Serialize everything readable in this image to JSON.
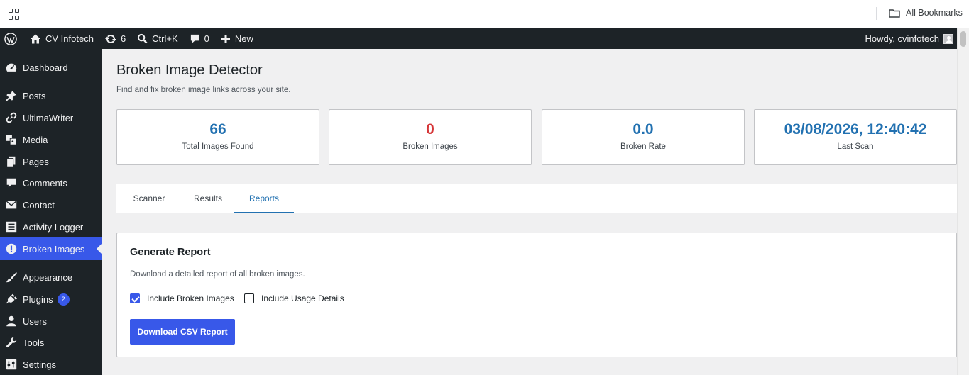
{
  "bookmarks_bar": {
    "all_bookmarks": "All Bookmarks"
  },
  "admin_bar": {
    "site_name": "CV Infotech",
    "updates_count": "6",
    "search_shortcut": "Ctrl+K",
    "comments_count": "0",
    "new_label": "New",
    "howdy": "Howdy, cvinfotech"
  },
  "sidebar": {
    "items": [
      {
        "label": "Dashboard",
        "icon": "dashboard-icon"
      },
      {
        "label": "Posts",
        "icon": "pin-icon"
      },
      {
        "label": "UltimaWriter",
        "icon": "link-icon"
      },
      {
        "label": "Media",
        "icon": "media-icon"
      },
      {
        "label": "Pages",
        "icon": "pages-icon"
      },
      {
        "label": "Comments",
        "icon": "comment-icon"
      },
      {
        "label": "Contact",
        "icon": "mail-icon"
      },
      {
        "label": "Activity Logger",
        "icon": "list-icon"
      },
      {
        "label": "Broken Images",
        "icon": "alert-icon"
      },
      {
        "label": "Appearance",
        "icon": "brush-icon"
      },
      {
        "label": "Plugins",
        "icon": "plugin-icon",
        "badge": "2"
      },
      {
        "label": "Users",
        "icon": "user-icon"
      },
      {
        "label": "Tools",
        "icon": "wrench-icon"
      },
      {
        "label": "Settings",
        "icon": "settings-icon"
      }
    ],
    "active": "Broken Images"
  },
  "page": {
    "title": "Broken Image Detector",
    "description": "Find and fix broken image links across your site."
  },
  "stats": [
    {
      "value": "66",
      "label": "Total Images Found"
    },
    {
      "value": "0",
      "label": "Broken Images"
    },
    {
      "value": "0.0",
      "label": "Broken Rate"
    },
    {
      "value": "03/08/2026, 12:40:42",
      "label": "Last Scan"
    }
  ],
  "tabs": [
    {
      "label": "Scanner"
    },
    {
      "label": "Results"
    },
    {
      "label": "Reports"
    }
  ],
  "active_tab": "Reports",
  "report": {
    "title": "Generate Report",
    "description": "Download a detailed report of all broken images.",
    "include_broken_label": "Include Broken Images",
    "include_broken_checked": true,
    "include_usage_label": "Include Usage Details",
    "include_usage_checked": false,
    "download_button": "Download CSV Report"
  },
  "colors": {
    "admin_dark": "#1d2327",
    "accent": "#3858e9",
    "link_blue": "#2271b1",
    "error_red": "#d63638"
  }
}
